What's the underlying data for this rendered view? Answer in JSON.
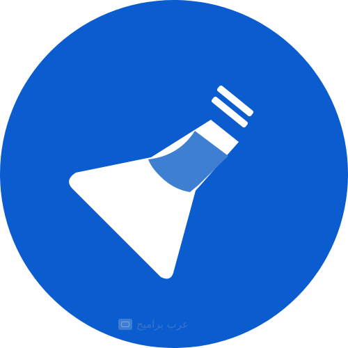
{
  "logo": {
    "icon": "flask-icon",
    "circle_color": "#0a5ccf",
    "flask_color": "#ffffff",
    "liquid_color": "#3f7fd1"
  },
  "watermark": {
    "icon": "monitor-icon",
    "text": "عرب براميج"
  }
}
